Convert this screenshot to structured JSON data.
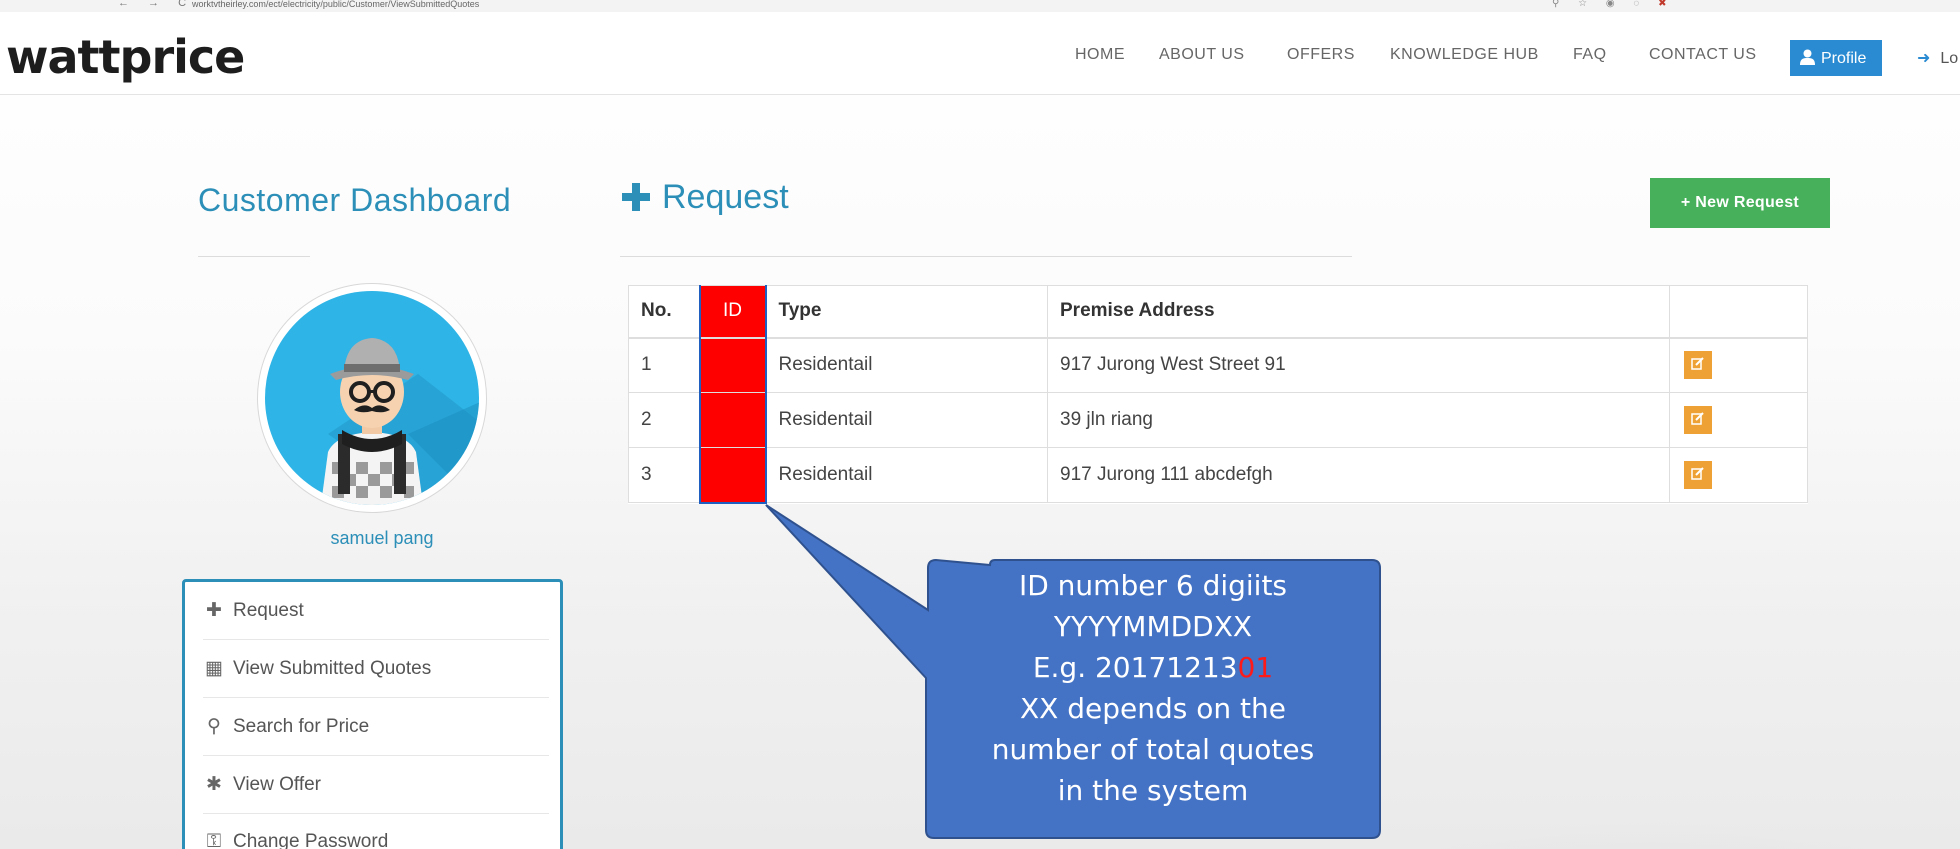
{
  "browser": {
    "nav_glyphs": "← → C",
    "url": "worktvtheirley.com/ect/electricity/public/Customer/ViewSubmittedQuotes"
  },
  "header": {
    "logo": "wattprice",
    "nav": [
      "HOME",
      "ABOUT US",
      "OFFERS",
      "KNOWLEDGE HUB",
      "FAQ",
      "CONTACT US"
    ],
    "profile_label": "Profile",
    "logout_label": "Lo"
  },
  "sidebar": {
    "title": "Customer Dashboard",
    "user_name": "samuel pang",
    "menu": [
      {
        "label": "Request",
        "icon": "plus-icon",
        "glyph": "✚"
      },
      {
        "label": "View Submitted Quotes",
        "icon": "table-icon",
        "glyph": "▦"
      },
      {
        "label": "Search for Price",
        "icon": "search-icon",
        "glyph": "⚲"
      },
      {
        "label": "View Offer",
        "icon": "asterisk-icon",
        "glyph": "✱"
      },
      {
        "label": "Change Password",
        "icon": "key-icon",
        "glyph": "⚿"
      }
    ]
  },
  "main": {
    "title": "Request",
    "new_request_label": "+ New Request",
    "table": {
      "headers": [
        "No.",
        "ID",
        "Type",
        "Premise Address",
        ""
      ],
      "rows": [
        {
          "no": "1",
          "id": "",
          "type": "Residentail",
          "address": "917 Jurong West Street 91"
        },
        {
          "no": "2",
          "id": "",
          "type": "Residentail",
          "address": "39 jln riang"
        },
        {
          "no": "3",
          "id": "",
          "type": "Residentail",
          "address": "917 Jurong 111 abcdefgh"
        }
      ]
    }
  },
  "annotation": {
    "line1": "ID number 6 digiits",
    "line2": "YYYYMMDDXX",
    "line3_prefix": "E.g. 201712",
    "line3_mid": "13",
    "line3_highlight": "01",
    "line4": "XX depends on the",
    "line5": "number of total quotes",
    "line6": "in the system"
  },
  "colors": {
    "accent": "#2c8fb8",
    "profile_button": "#2b8bd2",
    "new_request_button": "#46b05a",
    "edit_button": "#eea236",
    "id_highlight": "#ff0000",
    "callout_fill": "#4472c4",
    "callout_border": "#2f528f"
  }
}
